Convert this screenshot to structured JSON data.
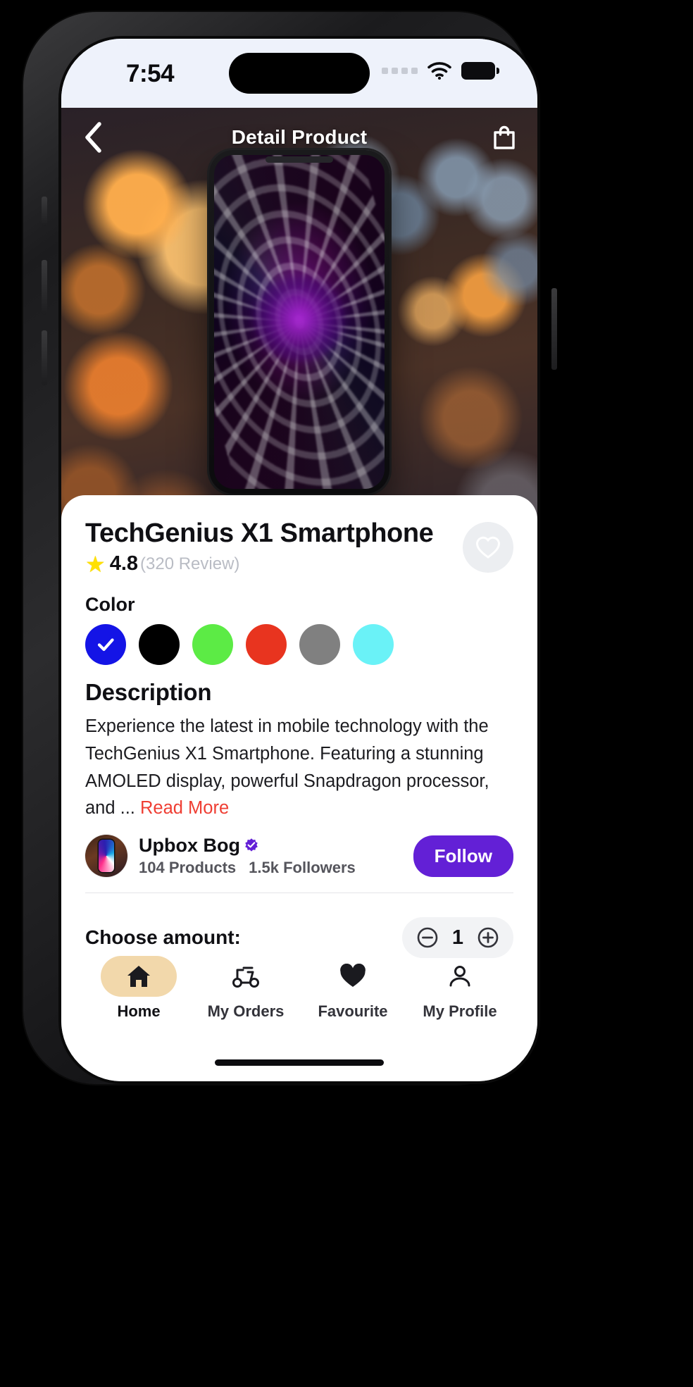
{
  "status_bar": {
    "time": "7:54",
    "signal_icon": "signal-dots-icon",
    "wifi_icon": "wifi-icon",
    "battery_icon": "battery-full-icon"
  },
  "header": {
    "title": "Detail Product",
    "back_icon": "chevron-left-icon",
    "cart_icon": "shopping-bag-icon"
  },
  "product": {
    "title": "TechGenius X1 Smartphone",
    "rating_value": "4.8",
    "review_count": "(320 Review)",
    "star_icon": "star-icon",
    "favourite_icon": "heart-outline-icon"
  },
  "color_section": {
    "label": "Color",
    "check_icon": "check-icon",
    "options": [
      {
        "name": "blue",
        "hex": "#1414e6",
        "selected": true
      },
      {
        "name": "black",
        "hex": "#000000",
        "selected": false
      },
      {
        "name": "green",
        "hex": "#5ceb45",
        "selected": false
      },
      {
        "name": "red",
        "hex": "#e8341f",
        "selected": false
      },
      {
        "name": "gray",
        "hex": "#808080",
        "selected": false
      },
      {
        "name": "cyan",
        "hex": "#6af2f7",
        "selected": false
      }
    ]
  },
  "description": {
    "heading": "Description",
    "body": "Experience the latest in mobile technology with the TechGenius X1 Smartphone. Featuring a stunning AMOLED display, powerful Snapdragon processor, and ... ",
    "read_more": "Read More",
    "read_more_color": "#ef3e33"
  },
  "seller": {
    "name": "Upbox Bog",
    "verified_icon": "verified-badge-icon",
    "products": "104 Products",
    "followers": "1.5k Followers",
    "follow_label": "Follow",
    "follow_color": "#6320d6",
    "avatar_icon": "seller-avatar"
  },
  "amount": {
    "label": "Choose amount:",
    "minus_icon": "minus-icon",
    "plus_icon": "plus-icon",
    "value": "1"
  },
  "tabbar": {
    "items": [
      {
        "label": "Home",
        "icon": "home-icon",
        "active": true
      },
      {
        "label": "My Orders",
        "icon": "scooter-icon",
        "active": false
      },
      {
        "label": "Favourite",
        "icon": "heart-icon",
        "active": false
      },
      {
        "label": "My Profile",
        "icon": "person-icon",
        "active": false
      }
    ],
    "active_pill_color": "#f2d8ab"
  }
}
